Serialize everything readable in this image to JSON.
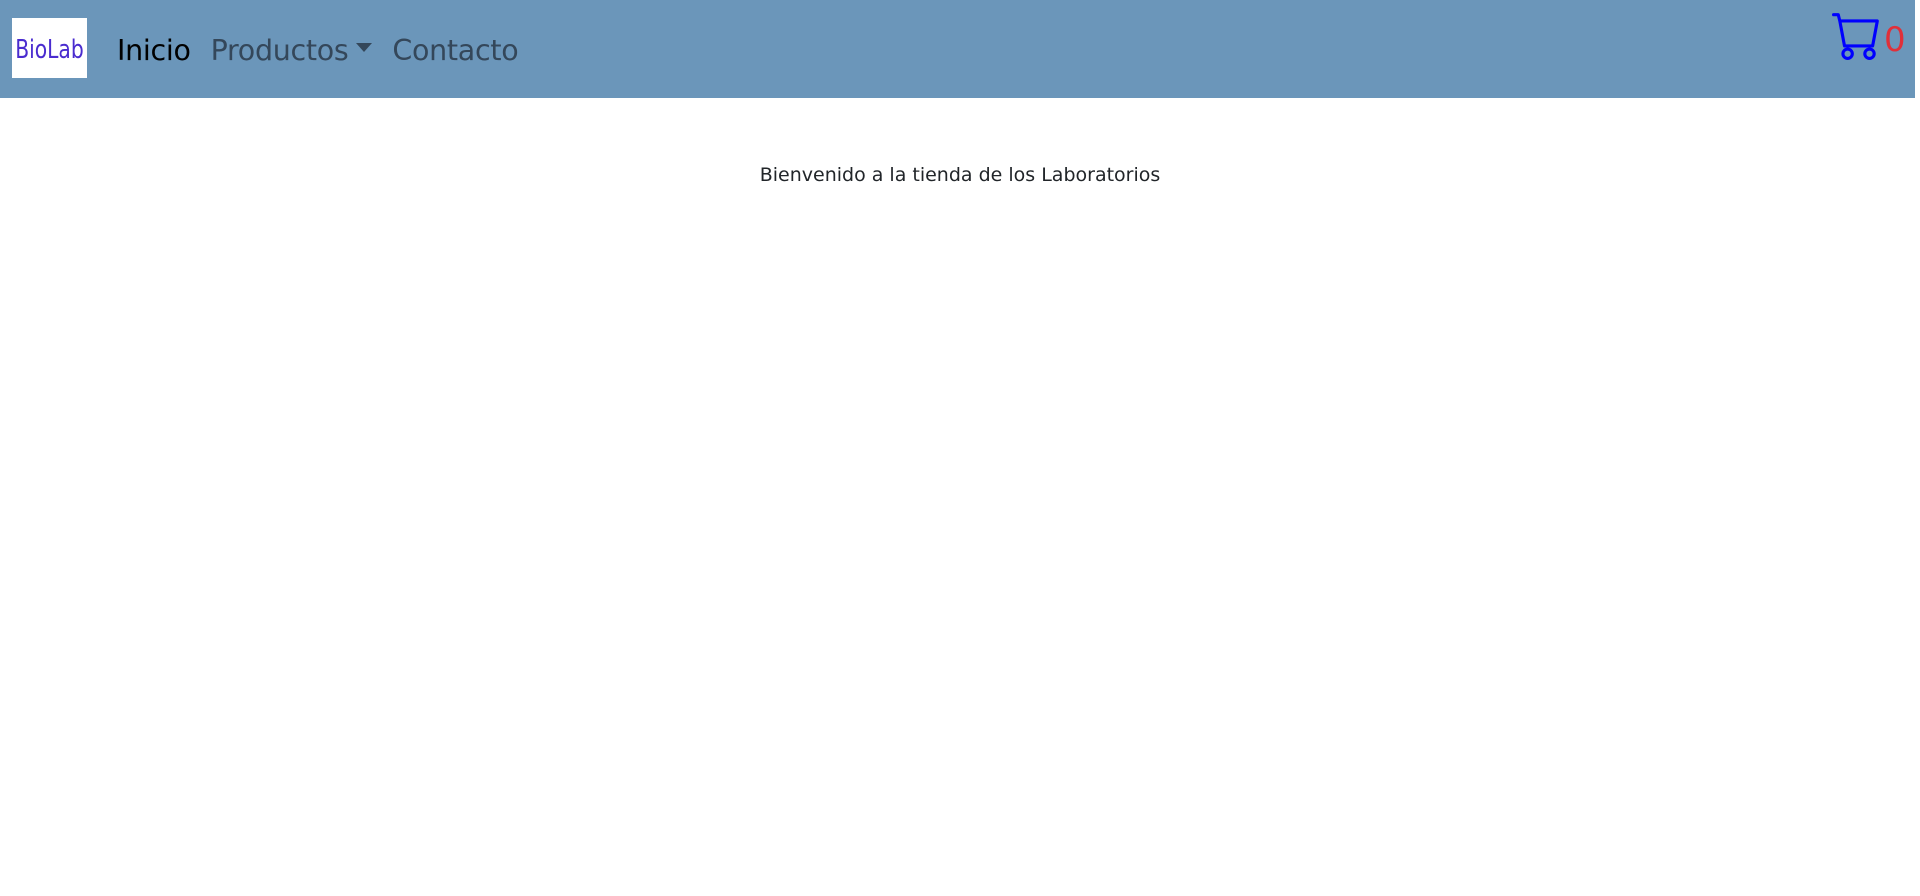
{
  "header": {
    "logo_text": "BioLab",
    "nav": {
      "home_label": "Inicio",
      "products_label": "Productos",
      "contact_label": "Contacto"
    },
    "cart": {
      "count": "0",
      "icon": "shopping-cart-icon"
    }
  },
  "main": {
    "welcome_text": "Bienvenido a la tienda de los Laboratorios"
  },
  "colors": {
    "navbar_bg": "#6b96ba",
    "cart_icon": "#0000ff",
    "cart_count": "#e0303a",
    "active_link": "#000000",
    "muted_link": "#34475a"
  }
}
